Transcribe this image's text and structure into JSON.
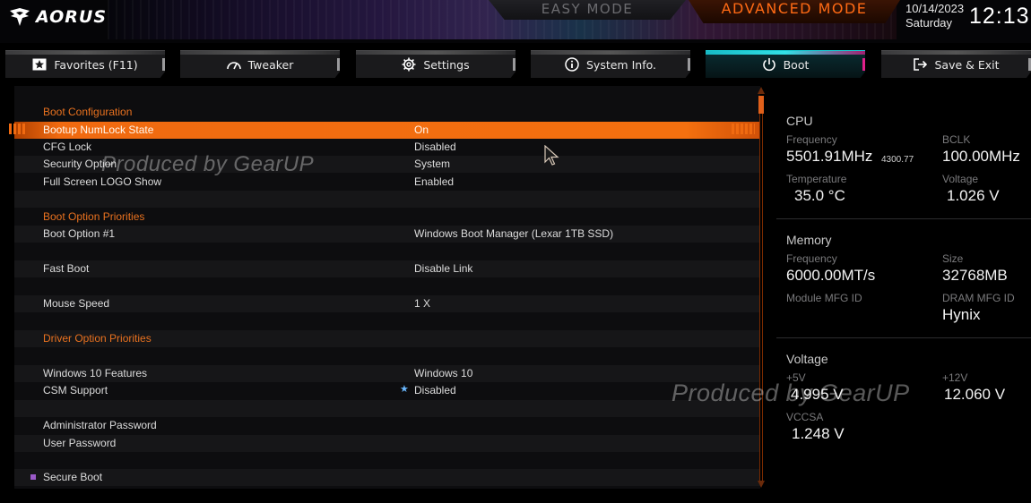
{
  "header": {
    "logo_text": "AORUS",
    "easy_mode": "EASY MODE",
    "advanced_mode": "ADVANCED MODE",
    "date": "10/14/2023",
    "day": "Saturday",
    "time": "12:13"
  },
  "tabs": [
    {
      "label": "Favorites (F11)",
      "icon": "star-box-icon"
    },
    {
      "label": "Tweaker",
      "icon": "gauge-icon"
    },
    {
      "label": "Settings",
      "icon": "gear-icon"
    },
    {
      "label": "System Info.",
      "icon": "info-icon"
    },
    {
      "label": "Boot",
      "icon": "power-icon",
      "active": true
    },
    {
      "label": "Save & Exit",
      "icon": "exit-icon"
    }
  ],
  "main": {
    "rows": [
      {
        "label": "Boot Configuration",
        "value": "",
        "type": "section"
      },
      {
        "label": "Bootup NumLock State",
        "value": "On",
        "type": "selected"
      },
      {
        "label": "CFG Lock",
        "value": "Disabled",
        "type": "item"
      },
      {
        "label": "Security Option",
        "value": "System",
        "type": "item"
      },
      {
        "label": "Full Screen LOGO Show",
        "value": "Enabled",
        "type": "item"
      },
      {
        "label": "",
        "value": "",
        "type": "blank"
      },
      {
        "label": "Boot Option Priorities",
        "value": "",
        "type": "section"
      },
      {
        "label": "Boot Option #1",
        "value": "Windows Boot Manager (Lexar 1TB SSD)",
        "type": "item"
      },
      {
        "label": "",
        "value": "",
        "type": "blank"
      },
      {
        "label": "Fast Boot",
        "value": "Disable Link",
        "type": "item"
      },
      {
        "label": "",
        "value": "",
        "type": "blank"
      },
      {
        "label": "Mouse Speed",
        "value": "1 X",
        "type": "item"
      },
      {
        "label": "",
        "value": "",
        "type": "blank"
      },
      {
        "label": "Driver Option Priorities",
        "value": "",
        "type": "section"
      },
      {
        "label": "",
        "value": "",
        "type": "blank"
      },
      {
        "label": "Windows 10 Features",
        "value": "Windows 10",
        "type": "item"
      },
      {
        "label": "CSM Support",
        "value": "Disabled",
        "type": "item",
        "marker": "star-icon"
      },
      {
        "label": "",
        "value": "",
        "type": "blank"
      },
      {
        "label": "Administrator Password",
        "value": "",
        "type": "item"
      },
      {
        "label": "User Password",
        "value": "",
        "type": "item"
      },
      {
        "label": "",
        "value": "",
        "type": "blank"
      },
      {
        "label": "Secure Boot",
        "value": "",
        "type": "item",
        "marker": "square-icon"
      }
    ],
    "watermark": "Produced by GearUP"
  },
  "info": {
    "cpu": {
      "title": "CPU",
      "freq_label": "Frequency",
      "freq_value": "5501.91MHz",
      "freq_sub": "4300.77",
      "bclk_label": "BCLK",
      "bclk_value": "100.00MHz",
      "temp_label": "Temperature",
      "temp_value": "35.0 °C",
      "volt_label": "Voltage",
      "volt_value": "1.026 V"
    },
    "memory": {
      "title": "Memory",
      "freq_label": "Frequency",
      "freq_value": "6000.00MT/s",
      "size_label": "Size",
      "size_value": "32768MB",
      "module_label": "Module MFG ID",
      "module_value": "",
      "dram_label": "DRAM MFG ID",
      "dram_value": "Hynix"
    },
    "voltage": {
      "title": "Voltage",
      "v5_label": "+5V",
      "v5_value": "4.995 V",
      "v12_label": "+12V",
      "v12_value": "12.060 V",
      "vccsa_label": "VCCSA",
      "vccsa_value": "1.248 V"
    },
    "watermark": "Produced by GearUP"
  },
  "colors": {
    "accent": "#f06a10",
    "section": "#e8711f",
    "active_tab": "#1ad0d8"
  }
}
